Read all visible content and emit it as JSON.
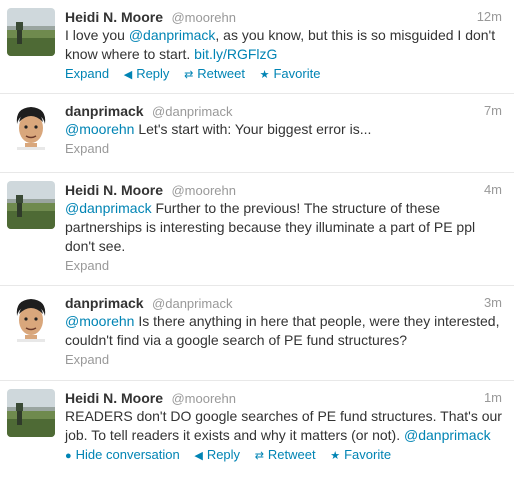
{
  "tweets": [
    {
      "fullname": "Heidi N. Moore",
      "username": "@moorehn",
      "time": "12m",
      "text": [
        {
          "t": "I love you ",
          "link": false
        },
        {
          "t": "@danprimack",
          "link": true
        },
        {
          "t": ", as you know, but this is so misguided I don't know where to start. ",
          "link": false
        },
        {
          "t": "bit.ly/RGFlzG",
          "link": true
        }
      ],
      "actions": [
        "Expand",
        "Reply",
        "Retweet",
        "Favorite"
      ]
    },
    {
      "fullname": "danprimack",
      "username": "@danprimack",
      "time": "7m",
      "text": [
        {
          "t": "@moorehn",
          "link": true
        },
        {
          "t": " Let's start with: Your biggest error is...",
          "link": false
        }
      ],
      "actions": [
        "Expand"
      ]
    },
    {
      "fullname": "Heidi N. Moore",
      "username": "@moorehn",
      "time": "4m",
      "text": [
        {
          "t": "@danprimack",
          "link": true
        },
        {
          "t": " Further to the previous! The structure of these partnerships is interesting because they illuminate a part of PE ppl don't see.",
          "link": false
        }
      ],
      "actions": [
        "Expand"
      ]
    },
    {
      "fullname": "danprimack",
      "username": "@danprimack",
      "time": "3m",
      "text": [
        {
          "t": "@moorehn",
          "link": true
        },
        {
          "t": " Is there anything in here that people, were they interested, couldn't find via a google search of PE fund structures?",
          "link": false
        }
      ],
      "actions": [
        "Expand"
      ]
    },
    {
      "fullname": "Heidi N. Moore",
      "username": "@moorehn",
      "time": "1m",
      "text": [
        {
          "t": "READERS don't DO google searches of PE fund structures. That's our job. To tell readers it exists and why it matters (or not). ",
          "link": false
        },
        {
          "t": "@danprimack",
          "link": true
        }
      ],
      "actions": [
        "Hide conversation",
        "Reply",
        "Retweet",
        "Favorite"
      ]
    }
  ],
  "icons": {
    "reply": "reply-arrow-icon",
    "retweet": "retweet-icon",
    "favorite": "star-icon",
    "hide": "speech-bubble-icon"
  },
  "colors": {
    "link": "#0084b4",
    "muted": "#999999",
    "text": "#333333",
    "divider": "#e8e8e8"
  }
}
